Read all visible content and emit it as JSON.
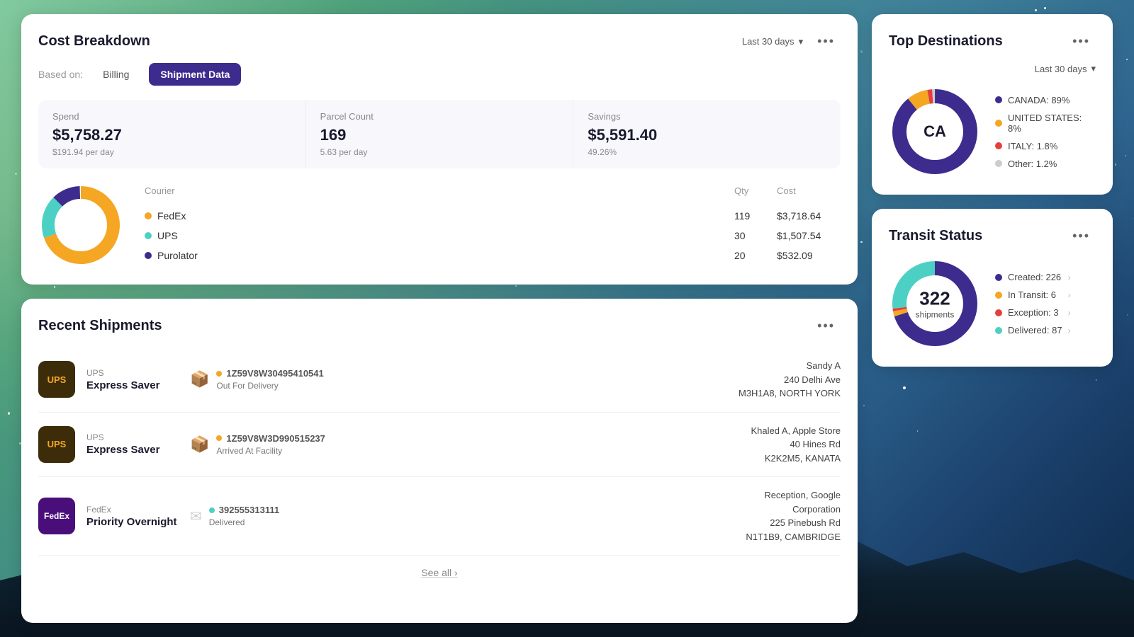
{
  "background": {
    "description": "night sky with mountains and stars"
  },
  "costBreakdown": {
    "title": "Cost Breakdown",
    "basedOnLabel": "Based on:",
    "tabs": [
      {
        "label": "Billing",
        "active": false
      },
      {
        "label": "Shipment Data",
        "active": true
      }
    ],
    "timeFilter": "Last 30 days",
    "stats": {
      "spend": {
        "label": "Spend",
        "value": "$5,758.27",
        "sub": "$191.94 per day"
      },
      "parcelCount": {
        "label": "Parcel Count",
        "value": "169",
        "sub": "5.63 per day"
      },
      "savings": {
        "label": "Savings",
        "value": "$5,591.40",
        "sub": "49.26%"
      }
    },
    "couriers": {
      "header": {
        "courier": "Courier",
        "qty": "Qty",
        "cost": "Cost"
      },
      "rows": [
        {
          "name": "FedEx",
          "color": "#f5a623",
          "qty": "119",
          "cost": "$3,718.64"
        },
        {
          "name": "UPS",
          "color": "#4dd0c4",
          "qty": "30",
          "cost": "$1,507.54"
        },
        {
          "name": "Purolator",
          "color": "#3d2c8d",
          "qty": "20",
          "cost": "$532.09"
        }
      ]
    },
    "donut": {
      "segments": [
        {
          "color": "#f5a623",
          "percent": 70
        },
        {
          "color": "#4dd0c4",
          "percent": 18
        },
        {
          "color": "#3d2c8d",
          "percent": 12
        }
      ]
    }
  },
  "recentShipments": {
    "title": "Recent Shipments",
    "shipments": [
      {
        "carrier": "UPS",
        "logoType": "ups",
        "service": "Express Saver",
        "trackingNum": "1Z59V8W30495410541",
        "statusDotColor": "#f5a623",
        "status": "Out For Delivery",
        "iconType": "box",
        "address": {
          "name": "Sandy A",
          "street": "240 Delhi Ave",
          "cityPostal": "M3H1A8, NORTH YORK"
        }
      },
      {
        "carrier": "UPS",
        "logoType": "ups",
        "service": "Express Saver",
        "trackingNum": "1Z59V8W3D990515237",
        "statusDotColor": "#f5a623",
        "status": "Arrived At Facility",
        "iconType": "box",
        "address": {
          "name": "Khaled A, Apple Store",
          "street": "40 Hines Rd",
          "cityPostal": "K2K2M5, KANATA"
        }
      },
      {
        "carrier": "FedEx",
        "logoType": "fedex",
        "service": "Priority Overnight",
        "trackingNum": "392555313111",
        "statusDotColor": "#4dd0c4",
        "status": "Delivered",
        "iconType": "envelope",
        "address": {
          "name": "Reception, Google",
          "street": "Corporation",
          "street2": "225 Pinebush Rd",
          "cityPostal": "N1T1B9, CAMBRIDGE"
        }
      }
    ],
    "seeAll": "See all"
  },
  "topDestinations": {
    "title": "Top Destinations",
    "timeFilter": "Last 30 days",
    "centerText": "CA",
    "donut": {
      "segments": [
        {
          "color": "#3d2c8d",
          "percent": 89,
          "label": "CANADA"
        },
        {
          "color": "#f5a623",
          "percent": 8,
          "label": "UNITED STATES"
        },
        {
          "color": "#e53e3e",
          "percent": 1.8,
          "label": "ITALY"
        },
        {
          "color": "#ccc",
          "percent": 1.2,
          "label": "Other"
        }
      ]
    },
    "legend": [
      {
        "color": "#3d2c8d",
        "text": "CANADA: 89%"
      },
      {
        "color": "#f5a623",
        "text": "UNITED STATES: 8%"
      },
      {
        "color": "#e53e3e",
        "text": "ITALY: 1.8%"
      },
      {
        "color": "#ccc",
        "text": "Other: 1.2%"
      }
    ]
  },
  "transitStatus": {
    "title": "Transit Status",
    "centerNum": "322",
    "centerSub": "shipments",
    "donut": {
      "segments": [
        {
          "color": "#3d2c8d",
          "percent": 70,
          "label": "Created"
        },
        {
          "color": "#f5a623",
          "percent": 2,
          "label": "In Transit"
        },
        {
          "color": "#e53e3e",
          "percent": 1,
          "label": "Exception"
        },
        {
          "color": "#4dd0c4",
          "percent": 27,
          "label": "Delivered"
        }
      ]
    },
    "legend": [
      {
        "color": "#3d2c8d",
        "text": "Created: 226"
      },
      {
        "color": "#f5a623",
        "text": "In Transit: 6"
      },
      {
        "color": "#e53e3e",
        "text": "Exception: 3"
      },
      {
        "color": "#4dd0c4",
        "text": "Delivered: 87"
      }
    ]
  },
  "icons": {
    "more": "•••",
    "chevronDown": "▾",
    "chevronRight": "›",
    "box": "📦",
    "envelope": "✉"
  }
}
